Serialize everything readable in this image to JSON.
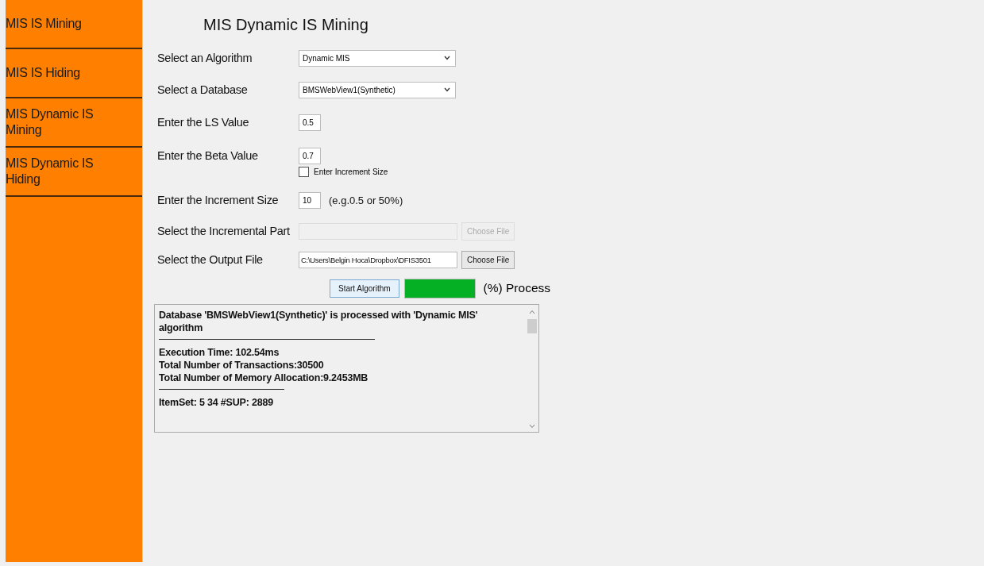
{
  "sidebar": {
    "items": [
      {
        "label": "MIS IS Mining"
      },
      {
        "label": "MIS IS Hiding"
      },
      {
        "label": "MIS Dynamic IS Mining"
      },
      {
        "label": "MIS Dynamic IS Hiding"
      }
    ]
  },
  "heading": "MIS Dynamic IS Mining",
  "form": [
    {
      "kind": "select",
      "label": "Select an Algorithm",
      "value": "Dynamic MIS"
    },
    {
      "kind": "select",
      "label": "Select a Database",
      "value": "BMSWebView1(Synthetic)"
    },
    {
      "kind": "text",
      "label": "Enter the LS Value",
      "value": "0.5"
    },
    {
      "kind": "text",
      "label": "Enter the Beta Value",
      "value": "0.7"
    },
    {
      "kind": "checkbox",
      "label": "Enter Increment Size",
      "checked": false
    },
    {
      "kind": "text",
      "label": "Enter the Increment Size",
      "value": "10",
      "hint": "(e.g.0.5 or 50%)"
    },
    {
      "kind": "file",
      "label": "Select the Incremental Part",
      "button": "Choose File",
      "disabled": true
    },
    {
      "kind": "file",
      "label": "Select the Output File",
      "value": "C:\\Users\\Belgin Hoca\\Dropbox\\DFIS3501",
      "button": "Choose File",
      "disabled": false
    }
  ],
  "start_button": "Start Algorithm",
  "progress": {
    "level": 1,
    "label": "(%) Process"
  },
  "log": {
    "lines": [
      {
        "kind": "text",
        "text": "Database 'BMSWebView1(Synthetic)' is processed with 'Dynamic MIS' algorithm"
      },
      {
        "kind": "rule"
      },
      {
        "kind": "text",
        "text": "Execution Time: 102.54ms"
      },
      {
        "kind": "text",
        "text": "Total Number of Transactions:30500"
      },
      {
        "kind": "text",
        "text": "Total Number of Memory Allocation:9.2453MB"
      },
      {
        "kind": "short-rule"
      },
      {
        "kind": "text",
        "text": "ItemSet: 5 34 #SUP: 2889"
      }
    ]
  }
}
